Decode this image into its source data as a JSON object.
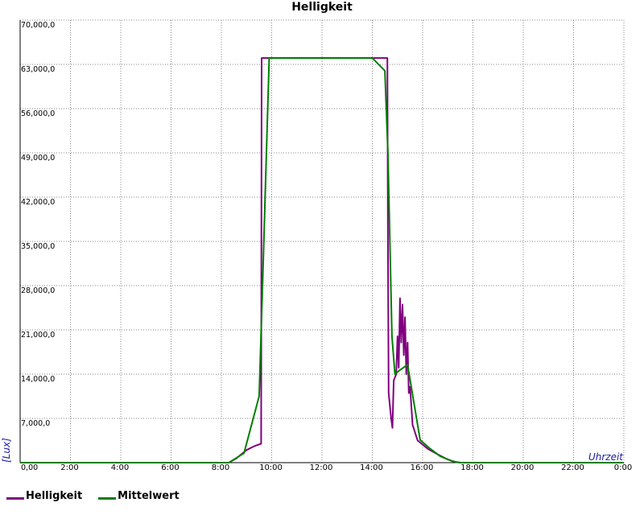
{
  "chart_data": {
    "type": "line",
    "title": "Helligkeit",
    "xlabel": "Uhrzeit",
    "ylabel": "[Lux]",
    "xlim": [
      0,
      24
    ],
    "ylim": [
      0,
      70000
    ],
    "grid": true,
    "legend_position": "bottom-left",
    "y_ticks": [
      {
        "value": 0,
        "label": "0,00"
      },
      {
        "value": 7000,
        "label": "7,000,0"
      },
      {
        "value": 14000,
        "label": "14,000,0"
      },
      {
        "value": 21000,
        "label": "21,000,0"
      },
      {
        "value": 28000,
        "label": "28,000,0"
      },
      {
        "value": 35000,
        "label": "35,000,0"
      },
      {
        "value": 42000,
        "label": "42,000,0"
      },
      {
        "value": 49000,
        "label": "49,000,0"
      },
      {
        "value": 56000,
        "label": "56,000,0"
      },
      {
        "value": 63000,
        "label": "63,000,0"
      },
      {
        "value": 70000,
        "label": "70,000,0"
      }
    ],
    "x_ticks": [
      {
        "value": 2,
        "label": "2:00"
      },
      {
        "value": 4,
        "label": "4:00"
      },
      {
        "value": 6,
        "label": "6:00"
      },
      {
        "value": 8,
        "label": "8:00"
      },
      {
        "value": 10,
        "label": "10:00"
      },
      {
        "value": 12,
        "label": "12:00"
      },
      {
        "value": 14,
        "label": "14:00"
      },
      {
        "value": 16,
        "label": "16:00"
      },
      {
        "value": 18,
        "label": "18:00"
      },
      {
        "value": 20,
        "label": "20:00"
      },
      {
        "value": 22,
        "label": "22:00"
      },
      {
        "value": 24,
        "label": "0:00"
      }
    ],
    "series": [
      {
        "name": "Helligkeit",
        "color": "#800080",
        "points": [
          [
            0,
            0
          ],
          [
            8.3,
            0
          ],
          [
            8.6,
            700
          ],
          [
            9.0,
            2000
          ],
          [
            9.3,
            2600
          ],
          [
            9.58,
            3000
          ],
          [
            9.6,
            64000
          ],
          [
            14.6,
            64000
          ],
          [
            14.62,
            35000
          ],
          [
            14.65,
            11000
          ],
          [
            14.75,
            7000
          ],
          [
            14.8,
            5500
          ],
          [
            14.85,
            13000
          ],
          [
            14.95,
            14000
          ],
          [
            15.0,
            20000
          ],
          [
            15.05,
            15000
          ],
          [
            15.1,
            26000
          ],
          [
            15.15,
            19000
          ],
          [
            15.2,
            25000
          ],
          [
            15.25,
            17000
          ],
          [
            15.3,
            23000
          ],
          [
            15.35,
            14000
          ],
          [
            15.4,
            19000
          ],
          [
            15.45,
            11000
          ],
          [
            15.5,
            12000
          ],
          [
            15.6,
            6000
          ],
          [
            15.8,
            3500
          ],
          [
            16.2,
            2200
          ],
          [
            16.6,
            1300
          ],
          [
            17.0,
            500
          ],
          [
            17.3,
            100
          ],
          [
            17.5,
            0
          ],
          [
            24,
            0
          ]
        ]
      },
      {
        "name": "Mittelwert",
        "color": "#008000",
        "points": [
          [
            0,
            0
          ],
          [
            8.3,
            0
          ],
          [
            8.9,
            1500
          ],
          [
            9.5,
            10500
          ],
          [
            9.65,
            30000
          ],
          [
            9.9,
            64000
          ],
          [
            14.0,
            64000
          ],
          [
            14.5,
            62000
          ],
          [
            14.62,
            49000
          ],
          [
            14.68,
            38000
          ],
          [
            14.78,
            20000
          ],
          [
            14.9,
            14000
          ],
          [
            15.05,
            14500
          ],
          [
            15.4,
            15500
          ],
          [
            15.9,
            3600
          ],
          [
            16.3,
            2200
          ],
          [
            16.7,
            1000
          ],
          [
            17.2,
            200
          ],
          [
            17.5,
            0
          ],
          [
            24,
            0
          ]
        ]
      }
    ]
  }
}
